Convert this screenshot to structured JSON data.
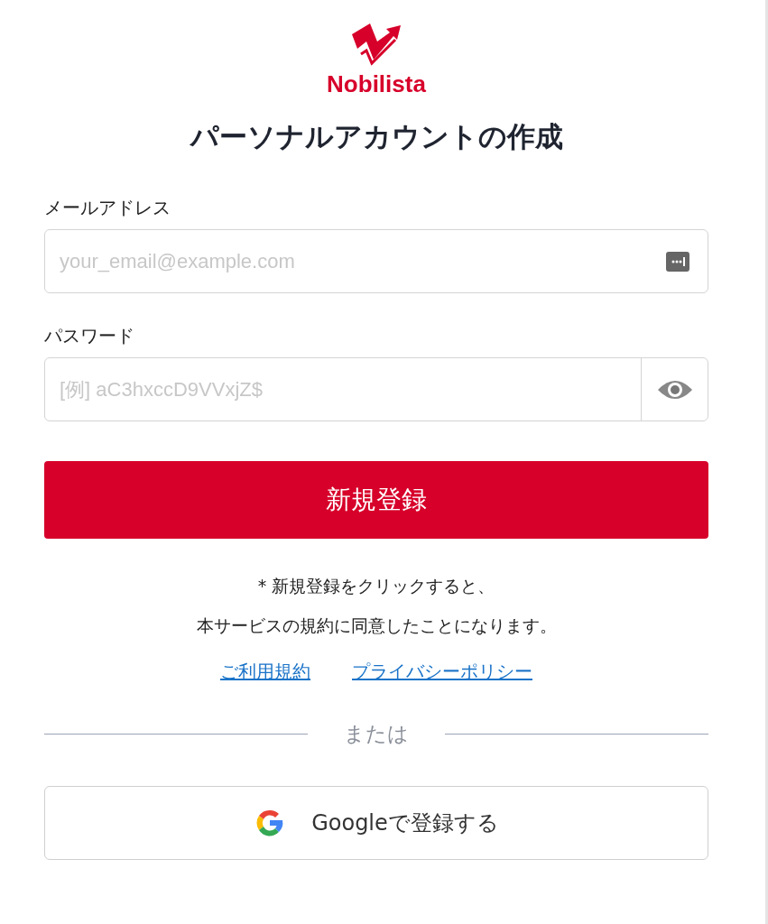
{
  "logo": {
    "text": "Nobilista"
  },
  "title": "パーソナルアカウントの作成",
  "fields": [
    {
      "label": "メールアドレス",
      "placeholder": "your_email@example.com",
      "kind": "email"
    },
    {
      "label": "パスワード",
      "placeholder": "[例] aC3hxccD9VVxjZ$",
      "kind": "password"
    }
  ],
  "submit": "新規登録",
  "notice": [
    "* 新規登録をクリックすると、",
    "本サービスの規約に同意したことになります。"
  ],
  "links": [
    "ご利用規約",
    "プライバシーポリシー"
  ],
  "divider": "または",
  "google_button": "Googleで登録する"
}
